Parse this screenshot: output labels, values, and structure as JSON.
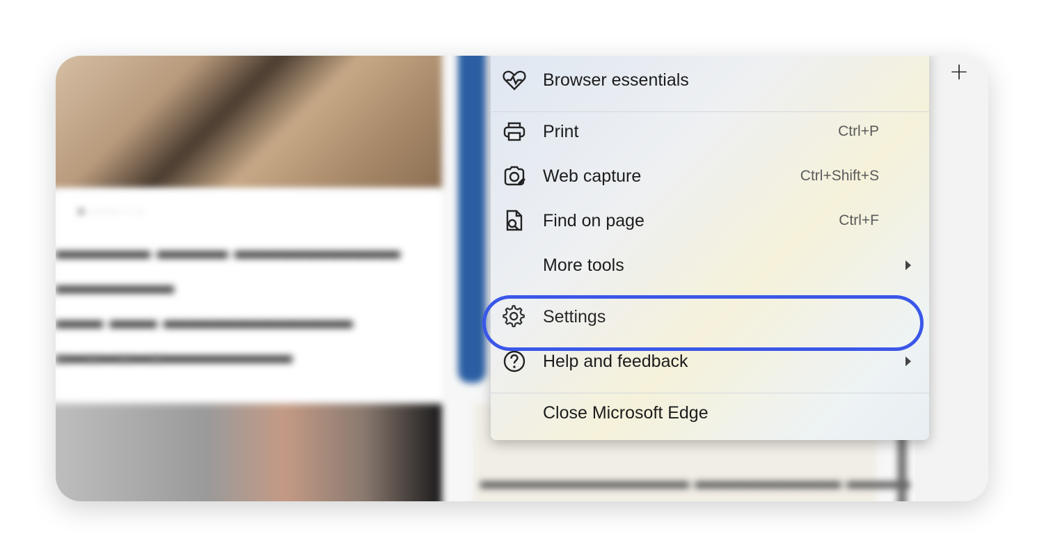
{
  "toolbar": {
    "new_tab_symbol": "+"
  },
  "menu": {
    "items": [
      {
        "label": "Browser essentials",
        "icon": "heart-pulse-icon",
        "shortcut": ""
      },
      {
        "label": "Print",
        "icon": "printer-icon",
        "shortcut": "Ctrl+P"
      },
      {
        "label": "Web capture",
        "icon": "web-capture-icon",
        "shortcut": "Ctrl+Shift+S"
      },
      {
        "label": "Find on page",
        "icon": "find-on-page-icon",
        "shortcut": "Ctrl+F"
      },
      {
        "label": "More tools",
        "icon": "",
        "shortcut": "",
        "submenu": true
      },
      {
        "label": "Settings",
        "icon": "gear-icon",
        "shortcut": "",
        "highlighted": true
      },
      {
        "label": "Help and feedback",
        "icon": "help-icon",
        "shortcut": "",
        "submenu": true
      },
      {
        "label": "Close Microsoft Edge",
        "icon": "",
        "shortcut": ""
      }
    ]
  },
  "colors": {
    "highlight": "#3a57e8",
    "accent_bar": "#2a5fa3"
  }
}
